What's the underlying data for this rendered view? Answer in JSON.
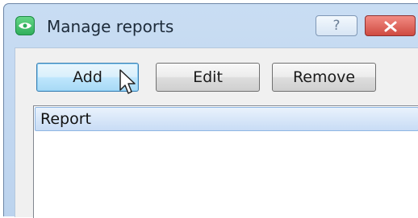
{
  "window": {
    "title": "Manage reports",
    "help_label": "?",
    "icon": "eye-app-icon",
    "close_icon": "close-icon"
  },
  "toolbar": {
    "add_label": "Add",
    "edit_label": "Edit",
    "remove_label": "Remove"
  },
  "list": {
    "items": [
      {
        "label": "Report",
        "selected": true
      }
    ]
  },
  "colors": {
    "titlebar": "#c9ddf3",
    "close_button": "#cf4b41",
    "selected_row": "#c8dcf5",
    "app_icon": "#2dae5a"
  }
}
